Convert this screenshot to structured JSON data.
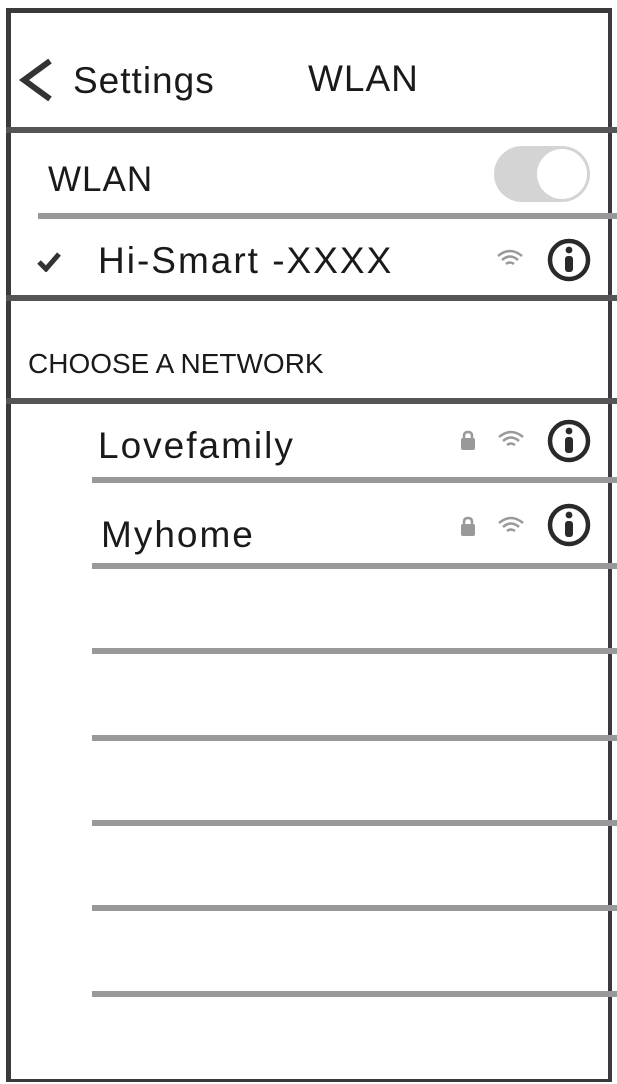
{
  "nav": {
    "back_label": "Settings",
    "title": "WLAN"
  },
  "wlan_toggle": {
    "label": "WLAN",
    "on": true
  },
  "connected": {
    "ssid": "Hi-Smart -XXXX"
  },
  "section_header": "CHOOSE A NETWORK",
  "networks": [
    {
      "ssid": "Lovefamily",
      "secured": true
    },
    {
      "ssid": "Myhome",
      "secured": true
    }
  ],
  "colors": {
    "line": "#999999",
    "frame": "#3a3a3a",
    "toggle": "#d4d4d4"
  }
}
